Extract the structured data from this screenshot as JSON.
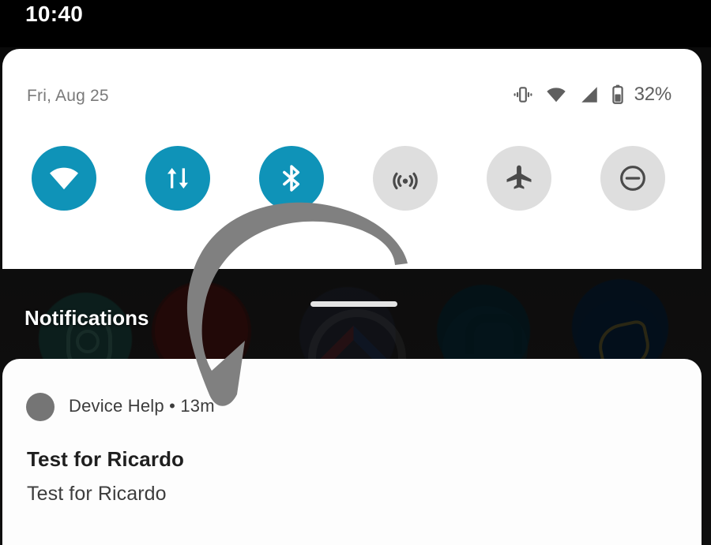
{
  "status_bar": {
    "clock": "10:40"
  },
  "quick_settings": {
    "date": "Fri, Aug 25",
    "battery_percent": "32%",
    "status_icons": [
      {
        "name": "vibrate-icon",
        "label": "Vibrate"
      },
      {
        "name": "wifi-status-icon",
        "label": "Wi-Fi"
      },
      {
        "name": "cellular-signal-icon",
        "label": "Signal"
      },
      {
        "name": "battery-icon",
        "label": "Battery"
      }
    ],
    "tiles": [
      {
        "name": "wifi-tile",
        "label": "Wi-Fi",
        "state": "on"
      },
      {
        "name": "mobile-data-tile",
        "label": "Mobile data",
        "state": "on"
      },
      {
        "name": "bluetooth-tile",
        "label": "Bluetooth",
        "state": "on"
      },
      {
        "name": "hotspot-tile",
        "label": "Hotspot",
        "state": "off"
      },
      {
        "name": "airplane-mode-tile",
        "label": "Airplane mode",
        "state": "off"
      },
      {
        "name": "do-not-disturb-tile",
        "label": "Do Not Disturb",
        "state": "off"
      }
    ],
    "drag_handle": "Expand"
  },
  "notifications": {
    "header": "Notifications",
    "items": [
      {
        "app_name": "Device Help",
        "separator": "•",
        "time": "13m",
        "meta": "Device Help • 13m",
        "title": "Test for Ricardo",
        "body": "Test for Ricardo"
      }
    ]
  },
  "annotation": {
    "arrow": "curved-down-left-arrow"
  },
  "colors": {
    "tile_active": "#0f93b8",
    "tile_inactive": "#dedede",
    "panel_background": "#ffffff",
    "status_bar": "#000000",
    "arrow": "#808080",
    "notification_title": "#1f1f1f"
  }
}
